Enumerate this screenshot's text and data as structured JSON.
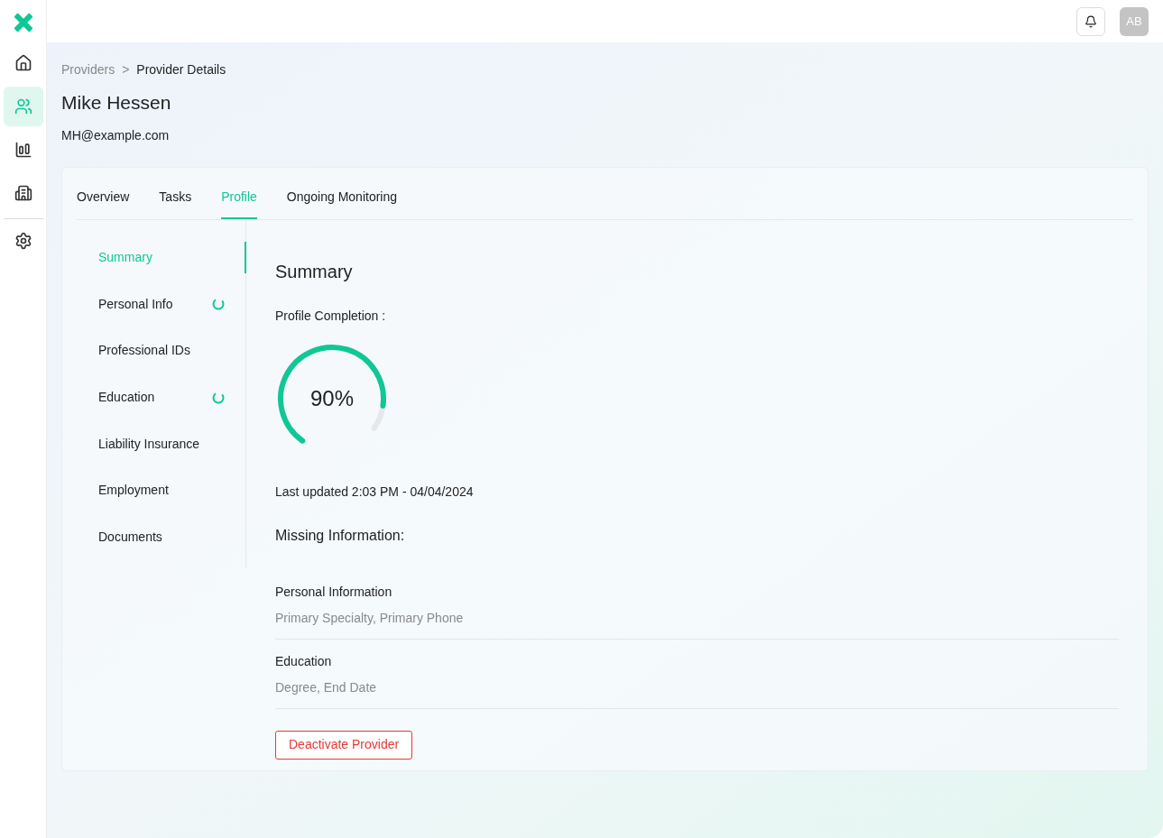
{
  "nav": [
    {
      "kind": "home",
      "selected": false
    },
    {
      "kind": "users",
      "selected": true
    },
    {
      "kind": "report",
      "selected": false
    },
    {
      "kind": "building",
      "selected": false
    },
    {
      "kind": "settings",
      "selected": false
    }
  ],
  "topbar": {
    "avatar": "AB"
  },
  "breadcrumb": [
    {
      "label": "Providers",
      "current": false
    },
    {
      "label": "Provider Details",
      "current": true
    }
  ],
  "breadcrumb_separator": ">",
  "provider": {
    "name": "Mike Hessen",
    "email": "MH@example.com"
  },
  "tabs": [
    {
      "label": "Overview",
      "selected": false
    },
    {
      "label": "Tasks",
      "selected": false
    },
    {
      "label": "Profile",
      "selected": true
    },
    {
      "label": "Ongoing Monitoring",
      "selected": false
    }
  ],
  "sections": [
    {
      "label": "Summary",
      "selected": true,
      "in_progress": false
    },
    {
      "label": "Personal Info",
      "selected": false,
      "in_progress": true
    },
    {
      "label": "Professional IDs",
      "selected": false,
      "in_progress": false
    },
    {
      "label": "Education",
      "selected": false,
      "in_progress": true
    },
    {
      "label": "Liability Insurance",
      "selected": false,
      "in_progress": false
    },
    {
      "label": "Employment",
      "selected": false,
      "in_progress": false
    },
    {
      "label": "Documents",
      "selected": false,
      "in_progress": false
    }
  ],
  "summary": {
    "title": "Summary",
    "completion_label": "Profile Completion :",
    "completion": {
      "level": 0.9,
      "reading": "90%"
    },
    "last_updated": "Last updated 2:03 PM - 04/04/2024",
    "missing_title": "Missing Information:",
    "missing": [
      {
        "title": "Personal Information",
        "fields": "Primary Specialty, Primary Phone"
      },
      {
        "title": "Education",
        "fields": "Degree, End Date"
      }
    ],
    "deactivate_button": "Deactivate Provider"
  }
}
